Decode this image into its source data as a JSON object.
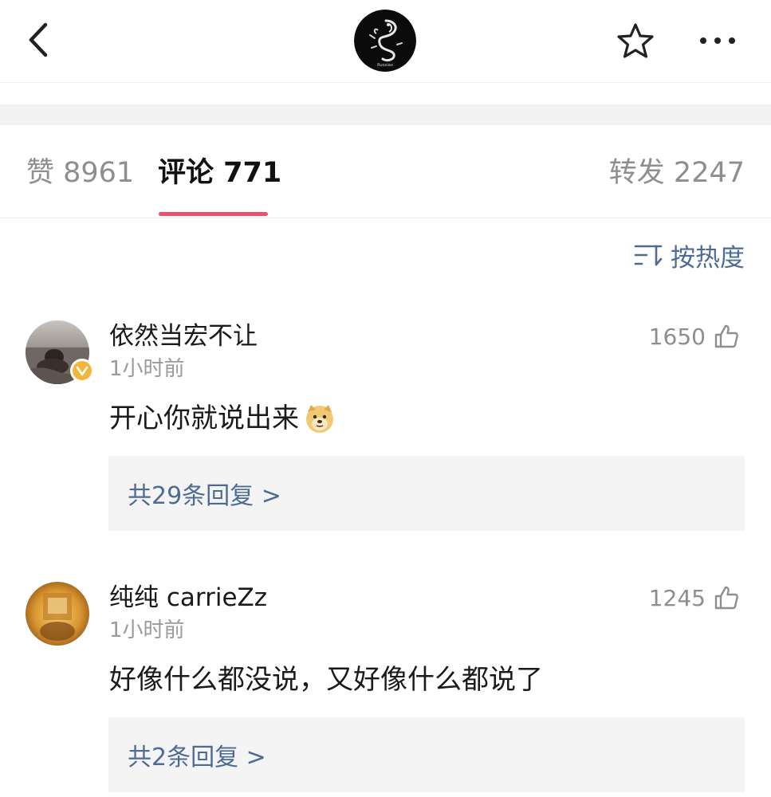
{
  "header": {
    "back_icon": "chevron-left-icon",
    "logo_text": "Ruoxiao",
    "star_icon": "star-outline-icon",
    "more_icon": "more-dots-icon"
  },
  "tabs": {
    "likes": "赞 8961",
    "comments": "评论 771",
    "reposts": "转发 2247",
    "active": "comments",
    "underline_color": "#e8536b"
  },
  "sort": {
    "icon": "sort-icon",
    "label": "按热度",
    "color": "#4e6b95"
  },
  "comments": [
    {
      "name": "依然当宏不让",
      "time": "1小时前",
      "likes": "1650",
      "text": "开心你就说出来",
      "emoji_icon": "doge-emoji-icon",
      "verified": true,
      "replies": "共29条回复 >"
    },
    {
      "name": "纯纯 carrieZz",
      "time": "1小时前",
      "likes": "1245",
      "text": "好像什么都没说，又好像什么都说了",
      "verified": false,
      "replies": "共2条回复 >"
    }
  ]
}
